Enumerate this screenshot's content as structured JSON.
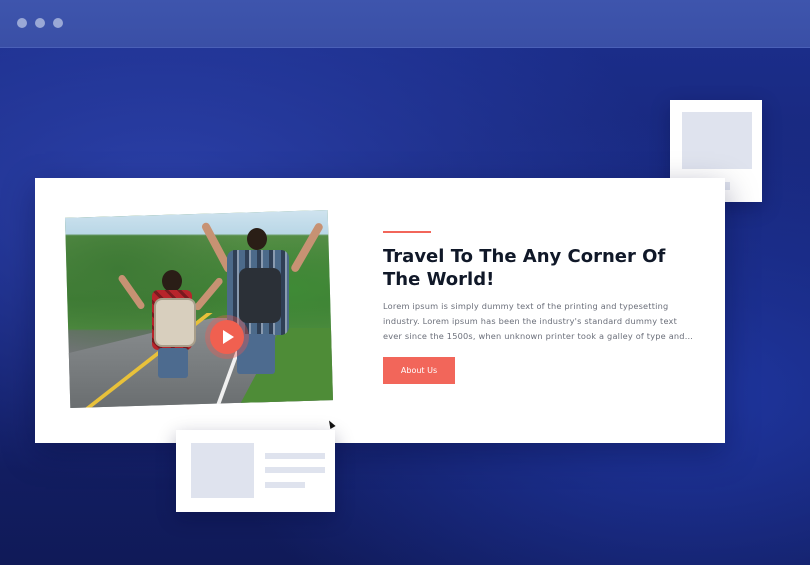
{
  "browser": {
    "window_controls": [
      "dot",
      "dot",
      "dot"
    ]
  },
  "hero": {
    "headline": "Travel To The Any Corner Of The World!",
    "body": "Lorem ipsum is simply dummy text of the printing and typesetting industry. Lorem ipsum has been the industry's standard dummy text ever since the 1500s, when unknown printer took a galley of type and...",
    "button_label": "About Us",
    "image_subject": "two backpackers with raised arms on a road",
    "play_icon": "play-icon"
  },
  "colors": {
    "accent": "#f2665a",
    "background": "#1c2f8e",
    "heading": "#101828",
    "placeholder": "#dfe3ee"
  }
}
